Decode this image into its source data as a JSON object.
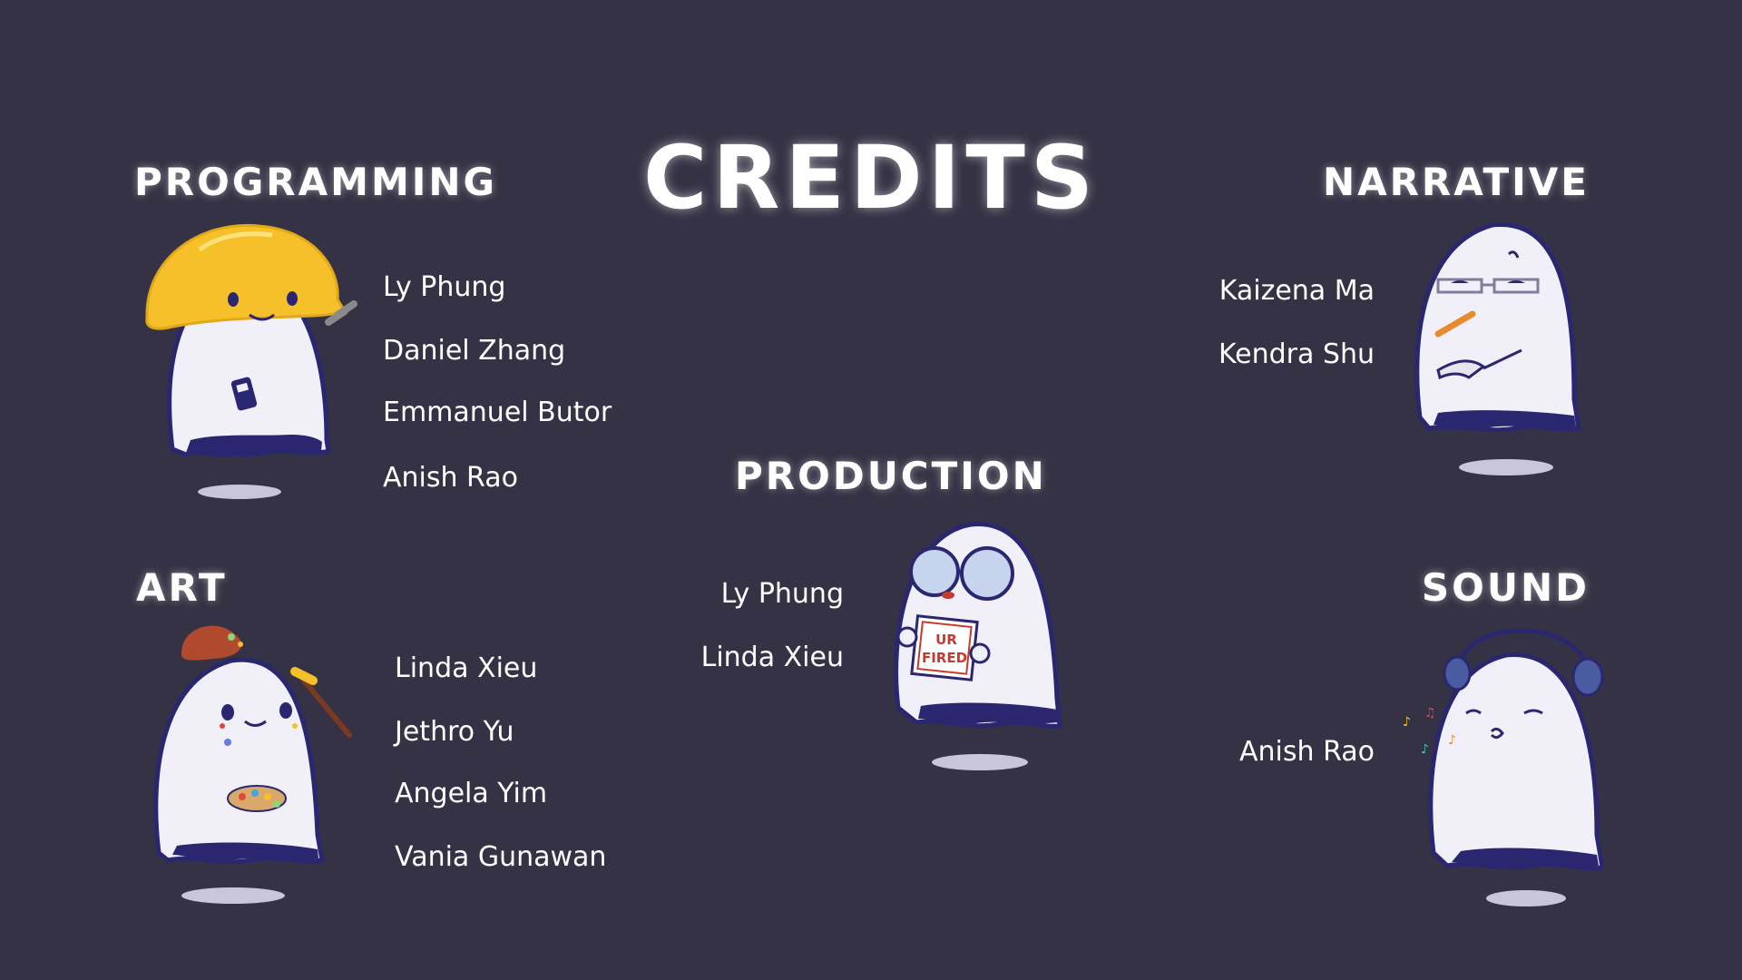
{
  "title": "CREDITS",
  "sections": {
    "programming": {
      "heading": "PROGRAMMING",
      "names": [
        "Ly Phung",
        "Daniel Zhang",
        "Emmanuel Butor",
        "Anish Rao"
      ]
    },
    "narrative": {
      "heading": "NARRATIVE",
      "names": [
        "Kaizena Ma",
        "Kendra Shu"
      ]
    },
    "production": {
      "heading": "PRODUCTION",
      "names": [
        "Ly Phung",
        "Linda Xieu"
      ],
      "sign_text": [
        "UR",
        "FIRED"
      ]
    },
    "art": {
      "heading": "ART",
      "names": [
        "Linda Xieu",
        "Jethro Yu",
        "Angela Yim",
        "Vania Gunawan"
      ]
    },
    "sound": {
      "heading": "SOUND",
      "names": [
        "Anish Rao"
      ]
    }
  },
  "colors": {
    "background": "#343244",
    "ghost_body": "#f1f0f8",
    "ghost_outline": "#2a2770",
    "shadow": "#c9c6d9",
    "hardhat": "#f5c02a"
  }
}
